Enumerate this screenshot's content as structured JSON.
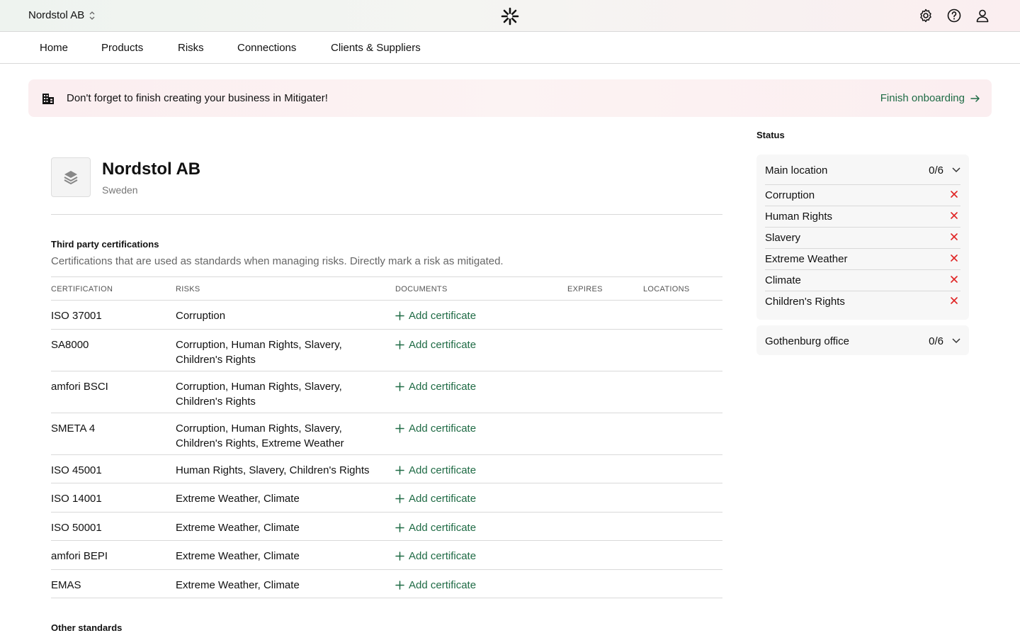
{
  "header": {
    "org_name": "Nordstol AB",
    "icons": [
      "settings-icon",
      "help-icon",
      "user-icon"
    ]
  },
  "nav": {
    "items": [
      {
        "label": "Home"
      },
      {
        "label": "Products"
      },
      {
        "label": "Risks"
      },
      {
        "label": "Connections"
      },
      {
        "label": "Clients & Suppliers"
      }
    ]
  },
  "banner": {
    "text": "Don't forget to finish creating your business in Mitigater!",
    "link": "Finish onboarding"
  },
  "company": {
    "name": "Nordstol AB",
    "country": "Sweden"
  },
  "certifications": {
    "title": "Third party certifications",
    "description": "Certifications that are used as standards when managing risks. Directly mark a risk as mitigated.",
    "columns": [
      "CERTIFICATION",
      "RISKS",
      "DOCUMENTS",
      "EXPIRES",
      "LOCATIONS"
    ],
    "add_label": "Add certificate",
    "rows": [
      {
        "cert": "ISO 37001",
        "risks": "Corruption"
      },
      {
        "cert": "SA8000",
        "risks": "Corruption, Human Rights, Slavery, Children's Rights"
      },
      {
        "cert": "amfori BSCI",
        "risks": "Corruption, Human Rights, Slavery, Children's Rights"
      },
      {
        "cert": "SMETA 4",
        "risks": "Corruption, Human Rights, Slavery, Children's Rights, Extreme Weather"
      },
      {
        "cert": "ISO 45001",
        "risks": "Human Rights, Slavery, Children's Rights"
      },
      {
        "cert": "ISO 14001",
        "risks": "Extreme Weather, Climate"
      },
      {
        "cert": "ISO 50001",
        "risks": "Extreme Weather, Climate"
      },
      {
        "cert": "amfori BEPI",
        "risks": "Extreme Weather, Climate"
      },
      {
        "cert": "EMAS",
        "risks": "Extreme Weather, Climate"
      }
    ]
  },
  "other_standards": {
    "title": "Other standards"
  },
  "status": {
    "title": "Status",
    "locations": [
      {
        "name": "Main location",
        "count": "0/6",
        "expanded": true,
        "risks": [
          "Corruption",
          "Human Rights",
          "Slavery",
          "Extreme Weather",
          "Climate",
          "Children's Rights"
        ]
      },
      {
        "name": "Gothenburg office",
        "count": "0/6",
        "expanded": false,
        "risks": []
      }
    ]
  },
  "colors": {
    "accent_green": "#1f6b45",
    "error_red": "#e02424"
  }
}
